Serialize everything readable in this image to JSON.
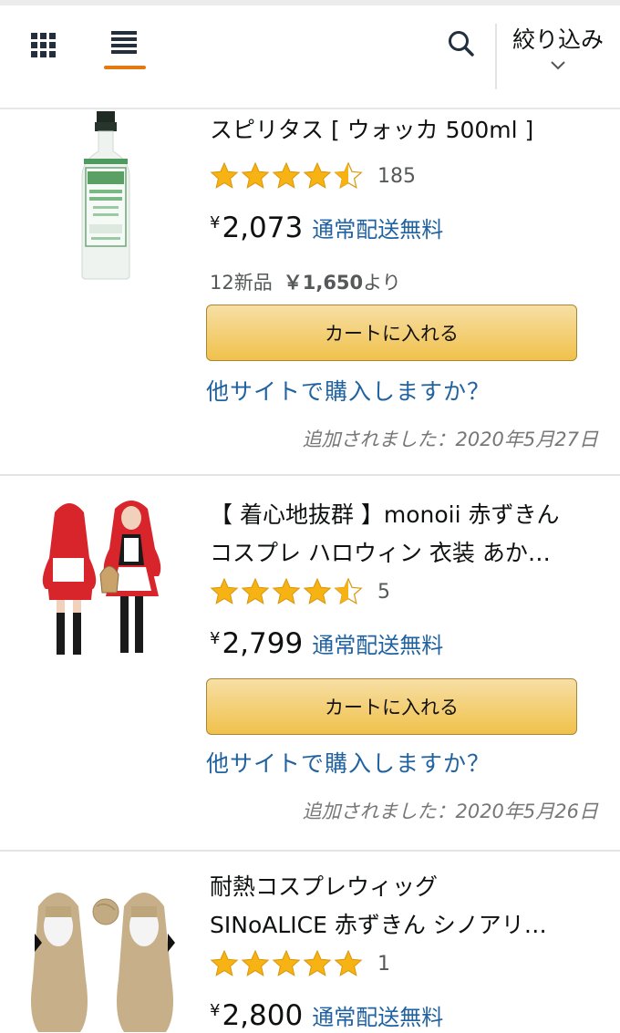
{
  "header": {
    "view_grid_icon": "grid-view-icon",
    "view_list_icon": "list-view-icon",
    "search_icon": "search-icon",
    "filter_label": "絞り込み",
    "filter_chevron_icon": "chevron-down-icon",
    "accent_color": "#e47911"
  },
  "items": [
    {
      "title_line1": "スピリタス [ ウォッカ 500ml ]",
      "title_line2": "",
      "rating": 4.5,
      "rating_count": "185",
      "price_symbol": "¥",
      "price": "2,073",
      "shipping": "通常配送無料",
      "offers_count": "12新品",
      "offers_price": "￥1,650",
      "offers_suffix": "より",
      "cart_label": "カートに入れる",
      "other_site": "他サイトで購入しますか？",
      "added": "追加されました：2020年5月27日"
    },
    {
      "title_line1": "【 着心地抜群 】monoii 赤ずきん",
      "title_line2": "コスプレ ハロウィン 衣装 あか…",
      "rating": 4.5,
      "rating_count": "5",
      "price_symbol": "¥",
      "price": "2,799",
      "shipping": "通常配送無料",
      "cart_label": "カートに入れる",
      "other_site": "他サイトで購入しますか？",
      "added": "追加されました：2020年5月26日"
    },
    {
      "title_line1": "耐熱コスプレウィッグ",
      "title_line2": "SINoALICE 赤ずきん シノアリ…",
      "rating": 5,
      "rating_count": "1",
      "price_symbol": "¥",
      "price": "2,800",
      "shipping": "通常配送無料"
    }
  ],
  "colors": {
    "star": "#f7b314",
    "link": "#2162a1",
    "cart_button": "#f0c14b"
  }
}
